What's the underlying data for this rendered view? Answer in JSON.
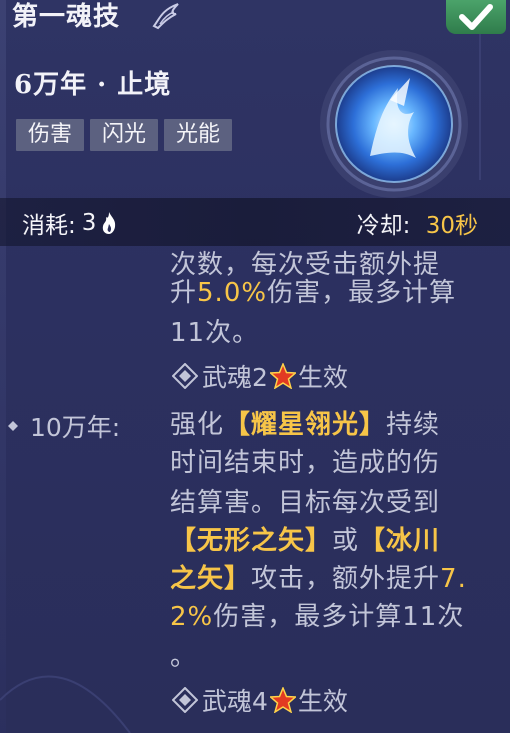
{
  "header": {
    "title": "第一魂技",
    "subtitle": "6万年 · 止境",
    "confirm_icon": "check-icon",
    "title_icon": "wing-icon"
  },
  "tags": [
    {
      "label": "伤害"
    },
    {
      "label": "闪光"
    },
    {
      "label": "光能"
    }
  ],
  "stats": {
    "cost_label": "消耗:",
    "cost_value": "3",
    "cost_icon": "flame-icon",
    "cooldown_label": "冷却:",
    "cooldown_value": "30秒"
  },
  "description": {
    "block1": {
      "line1": "次数，每次受击额外提",
      "line2_prefix": "升",
      "line2_value": "5.0%",
      "line2_suffix": "伤害，最多计算",
      "line3": "11次。"
    },
    "effect1": {
      "prefix": "武魂2",
      "suffix": "生效"
    },
    "tier2": {
      "label": "10万年:",
      "line1_prefix": "强化",
      "line1_highlight": "【耀星翎光】",
      "line1_suffix": "持续",
      "line2": "时间结束时，造成的伤",
      "line3": "结算害。目标每次受到",
      "line4_hl1": "【无形之矢】",
      "line4_mid": "或",
      "line4_hl2": "【冰川",
      "line5_hl": "之矢】",
      "line5_text": "攻击，额外提升",
      "line5_value": "7.",
      "line6_value": "2%",
      "line6_text": "伤害，最多计算11次",
      "line7": "。"
    },
    "effect2": {
      "prefix": "武魂4",
      "suffix": "生效"
    }
  },
  "colors": {
    "accent": "#f7c548",
    "confirm": "#3c9158",
    "text": "#c2c5d8",
    "tag_bg": "#5c6180"
  }
}
